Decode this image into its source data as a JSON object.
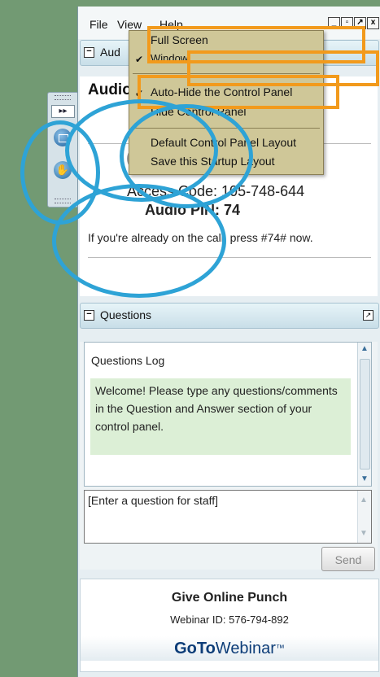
{
  "menubar": {
    "file": "File",
    "view": "View",
    "help": "Help"
  },
  "window_buttons": {
    "minimize": "_",
    "restore": "▫",
    "popout": "↗",
    "close": "x"
  },
  "view_menu": {
    "full_screen": "Full Screen",
    "window": "Window",
    "auto_hide": "Auto-Hide the Control Panel",
    "hide_panel": "Hide Control Panel",
    "default_layout": "Default Control Panel Layout",
    "save_layout": "Save this Startup Layout"
  },
  "audio": {
    "header_title": "Aud",
    "title": "Audio",
    "access_code": "Access Code:  105-748-644",
    "audio_pin": "Audio PIN:  74",
    "note": "If you're already on the call, press #74# now."
  },
  "questions": {
    "header_title": "Questions",
    "log_title": "Questions Log",
    "welcome": "Welcome! Please type any questions/comments in the Question and Answer section of your control panel.",
    "input_placeholder": "[Enter a question for staff]",
    "send_label": "Send"
  },
  "footer": {
    "webinar_name": "Give Online Punch",
    "webinar_id": "Webinar ID: 576-794-892",
    "brand_bold": "GoTo",
    "brand_light": "Webinar",
    "brand_tm": "™"
  },
  "colors": {
    "annotation_orange": "#f29a1c",
    "annotation_blue": "#2ea3d6",
    "background": "#729a73",
    "menu_bg": "#cfc798"
  }
}
